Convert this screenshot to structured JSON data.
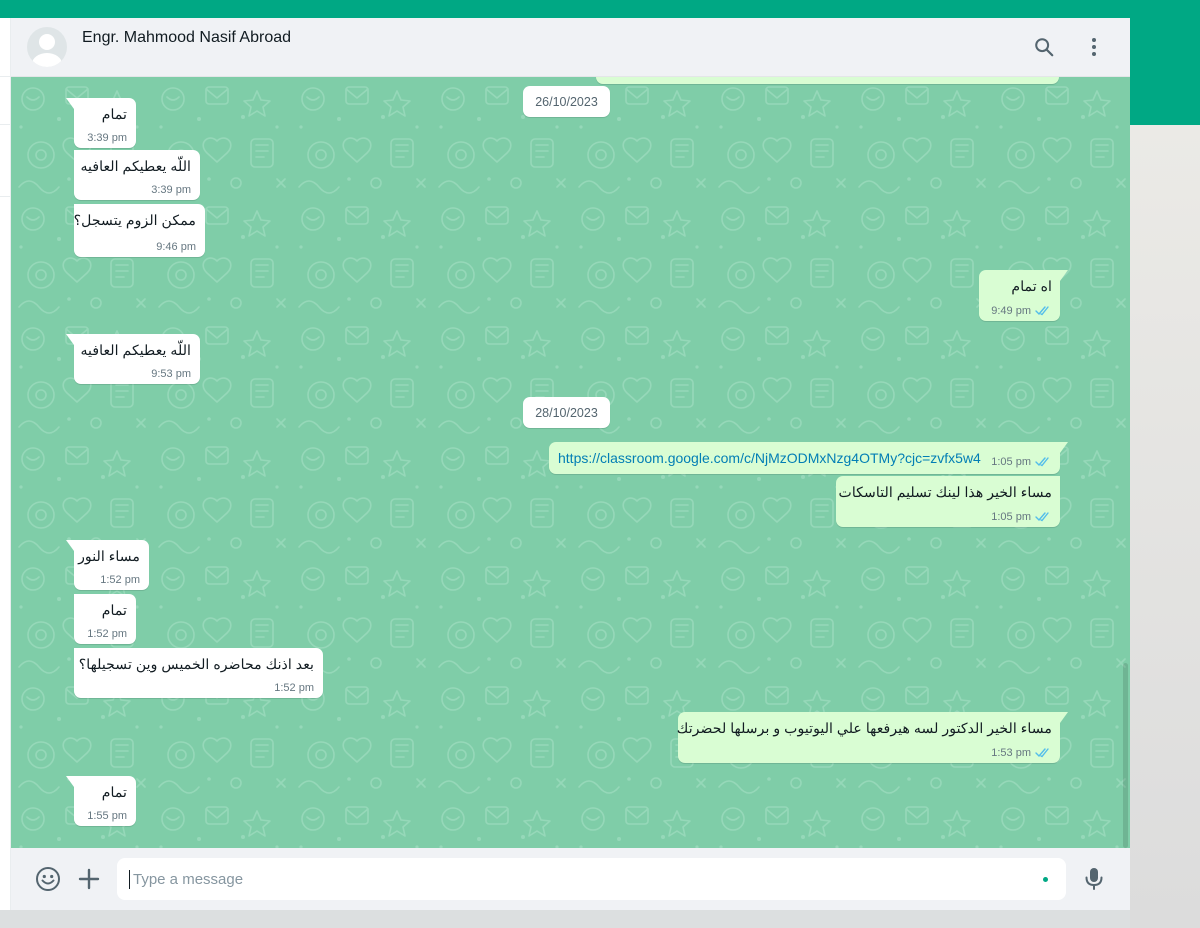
{
  "contact": {
    "name": "Engr. Mahmood Nasif Abroad"
  },
  "dates": [
    "26/10/2023",
    "28/10/2023"
  ],
  "messages": [
    {
      "dir": "in",
      "text": "تمام",
      "time": "3:39 pm"
    },
    {
      "dir": "in",
      "text": "اللّه يعطيكم العافيه",
      "time": "3:39 pm"
    },
    {
      "dir": "in",
      "text": "ممكن الزوم يتسجل؟",
      "time": "9:46 pm"
    },
    {
      "dir": "out",
      "text": "اه تمام",
      "time": "9:49 pm",
      "status": "read"
    },
    {
      "dir": "in",
      "text": "اللّه يعطيكم العافيه",
      "time": "9:53 pm"
    },
    {
      "dir": "out",
      "text": "https://classroom.google.com/c/NjMzODMxNzg4OTMy?cjc=zvfx5w4",
      "time": "1:05 pm",
      "status": "read",
      "is_link": true
    },
    {
      "dir": "out",
      "text": "مساء الخير هذا لينك تسليم التاسكات",
      "time": "1:05 pm",
      "status": "read"
    },
    {
      "dir": "in",
      "text": "مساء النور",
      "time": "1:52 pm"
    },
    {
      "dir": "in",
      "text": "تمام",
      "time": "1:52 pm"
    },
    {
      "dir": "in",
      "text": "بعد اذنك محاضره الخميس وين تسجيلها؟",
      "time": "1:52 pm"
    },
    {
      "dir": "out",
      "text": "مساء الخير الدكتور لسه هيرفعها علي اليوتيوب و برسلها لحضرتك",
      "time": "1:53 pm",
      "status": "read"
    },
    {
      "dir": "in",
      "text": "تمام",
      "time": "1:55 pm"
    }
  ],
  "composer": {
    "placeholder": "Type a message"
  },
  "icons": {
    "search": "search-icon",
    "menu": "menu-icon",
    "emoji": "emoji-icon",
    "attach": "plus-icon",
    "mic": "mic-icon",
    "read_receipt": "double-check-icon"
  },
  "colors": {
    "brand": "#00a884",
    "chat_bg": "#7fcda8",
    "incoming_bubble": "#ffffff",
    "outgoing_bubble": "#d9fdd3",
    "read_tick": "#53bdeb",
    "link": "#027eb5"
  }
}
